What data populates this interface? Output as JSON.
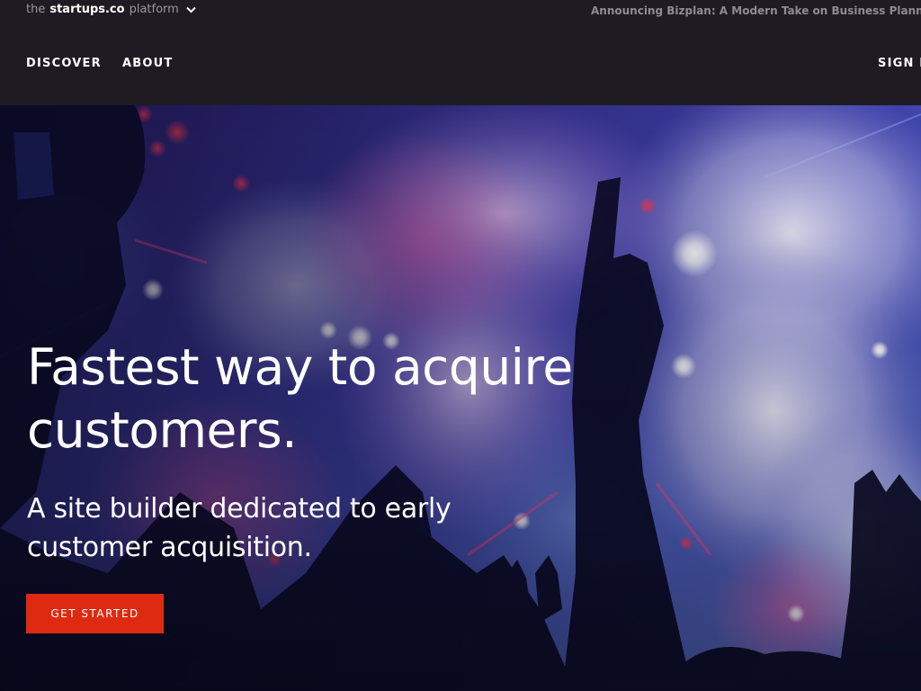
{
  "header": {
    "platform": {
      "prefix": "the",
      "brand": "startups.co",
      "suffix": "platform",
      "icon": "chevron-down-icon"
    },
    "announcement": "Announcing Bizplan: A Modern Take on Business Planning",
    "nav": {
      "discover": "DISCOVER",
      "about": "ABOUT",
      "signin": "SIGN IN"
    }
  },
  "hero": {
    "title": "Fastest way to acquire customers.",
    "subtitle": "A site builder dedicated to early customer acquisition.",
    "cta_label": "GET STARTED"
  },
  "colors": {
    "header_bg": "#1f1b23",
    "cta_bg": "#de2a11",
    "text": "#ffffff"
  }
}
